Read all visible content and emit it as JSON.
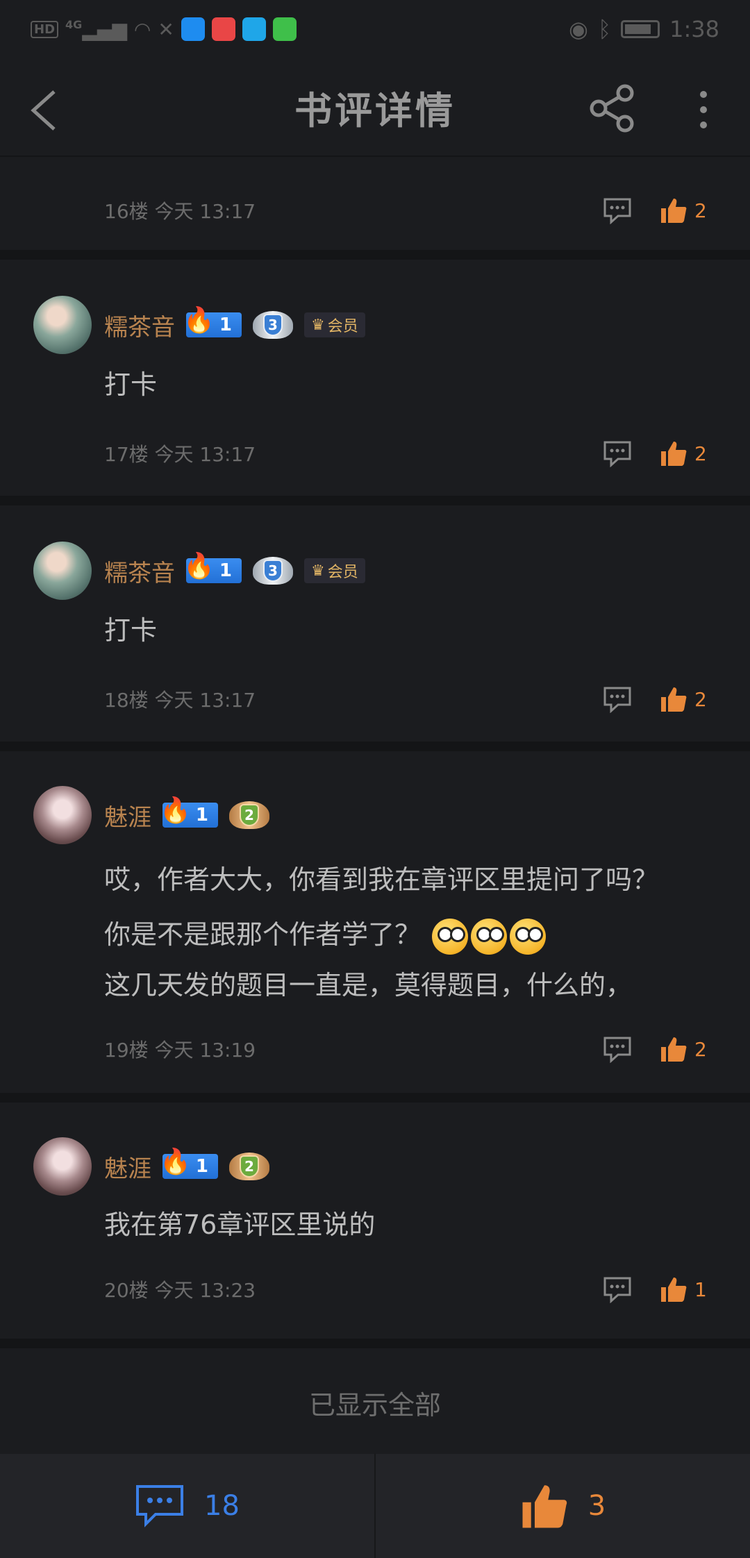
{
  "status_bar": {
    "left_badge": "HD",
    "network": "4G",
    "time": "1:38"
  },
  "header": {
    "title": "书评详情"
  },
  "comments": [
    {
      "floor_meta": "16楼 今天 13:17",
      "likes": "2"
    },
    {
      "username": "糯茶音",
      "level": "1",
      "rank": "3",
      "vip_label": "会员",
      "text": "打卡",
      "floor_meta": "17楼 今天 13:17",
      "likes": "2"
    },
    {
      "username": "糯茶音",
      "level": "1",
      "rank": "3",
      "vip_label": "会员",
      "text": "打卡",
      "floor_meta": "18楼 今天 13:17",
      "likes": "2"
    },
    {
      "username": "魅涯",
      "level": "1",
      "rank": "2",
      "text_line1": "哎，作者大大，你看到我在章评区里提问了吗？",
      "text_line2": "你是不是跟那个作者学了？",
      "text_line3": "这几天发的题目一直是，莫得题目，什么的，",
      "floor_meta": "19楼 今天 13:19",
      "likes": "2"
    },
    {
      "username": "魅涯",
      "level": "1",
      "rank": "2",
      "text": "我在第76章评区里说的",
      "floor_meta": "20楼 今天 13:23",
      "likes": "1"
    }
  ],
  "footer_note": "已显示全部",
  "bottom_bar": {
    "comment_count": "18",
    "like_count": "3"
  },
  "colors": {
    "background": "#1b1c1f",
    "username": "#b8834f",
    "like_accent": "#e8883a",
    "comment_accent": "#3b7fe6"
  }
}
